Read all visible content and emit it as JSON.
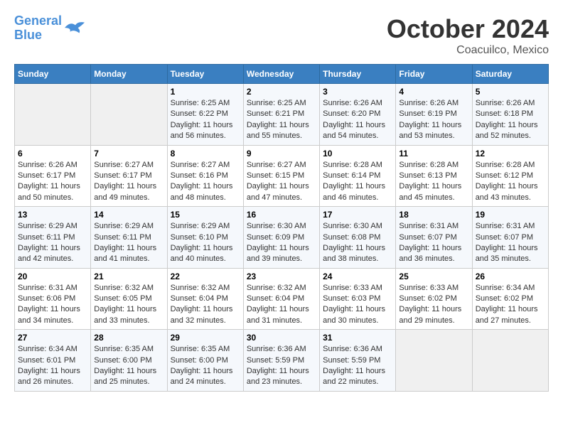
{
  "logo": {
    "line1": "General",
    "line2": "Blue"
  },
  "title": "October 2024",
  "location": "Coacuilco, Mexico",
  "weekdays": [
    "Sunday",
    "Monday",
    "Tuesday",
    "Wednesday",
    "Thursday",
    "Friday",
    "Saturday"
  ],
  "rows": [
    [
      {
        "day": "",
        "empty": true
      },
      {
        "day": "",
        "empty": true
      },
      {
        "day": "1",
        "sunrise": "Sunrise: 6:25 AM",
        "sunset": "Sunset: 6:22 PM",
        "daylight": "Daylight: 11 hours and 56 minutes."
      },
      {
        "day": "2",
        "sunrise": "Sunrise: 6:25 AM",
        "sunset": "Sunset: 6:21 PM",
        "daylight": "Daylight: 11 hours and 55 minutes."
      },
      {
        "day": "3",
        "sunrise": "Sunrise: 6:26 AM",
        "sunset": "Sunset: 6:20 PM",
        "daylight": "Daylight: 11 hours and 54 minutes."
      },
      {
        "day": "4",
        "sunrise": "Sunrise: 6:26 AM",
        "sunset": "Sunset: 6:19 PM",
        "daylight": "Daylight: 11 hours and 53 minutes."
      },
      {
        "day": "5",
        "sunrise": "Sunrise: 6:26 AM",
        "sunset": "Sunset: 6:18 PM",
        "daylight": "Daylight: 11 hours and 52 minutes."
      }
    ],
    [
      {
        "day": "6",
        "sunrise": "Sunrise: 6:26 AM",
        "sunset": "Sunset: 6:17 PM",
        "daylight": "Daylight: 11 hours and 50 minutes."
      },
      {
        "day": "7",
        "sunrise": "Sunrise: 6:27 AM",
        "sunset": "Sunset: 6:17 PM",
        "daylight": "Daylight: 11 hours and 49 minutes."
      },
      {
        "day": "8",
        "sunrise": "Sunrise: 6:27 AM",
        "sunset": "Sunset: 6:16 PM",
        "daylight": "Daylight: 11 hours and 48 minutes."
      },
      {
        "day": "9",
        "sunrise": "Sunrise: 6:27 AM",
        "sunset": "Sunset: 6:15 PM",
        "daylight": "Daylight: 11 hours and 47 minutes."
      },
      {
        "day": "10",
        "sunrise": "Sunrise: 6:28 AM",
        "sunset": "Sunset: 6:14 PM",
        "daylight": "Daylight: 11 hours and 46 minutes."
      },
      {
        "day": "11",
        "sunrise": "Sunrise: 6:28 AM",
        "sunset": "Sunset: 6:13 PM",
        "daylight": "Daylight: 11 hours and 45 minutes."
      },
      {
        "day": "12",
        "sunrise": "Sunrise: 6:28 AM",
        "sunset": "Sunset: 6:12 PM",
        "daylight": "Daylight: 11 hours and 43 minutes."
      }
    ],
    [
      {
        "day": "13",
        "sunrise": "Sunrise: 6:29 AM",
        "sunset": "Sunset: 6:11 PM",
        "daylight": "Daylight: 11 hours and 42 minutes."
      },
      {
        "day": "14",
        "sunrise": "Sunrise: 6:29 AM",
        "sunset": "Sunset: 6:11 PM",
        "daylight": "Daylight: 11 hours and 41 minutes."
      },
      {
        "day": "15",
        "sunrise": "Sunrise: 6:29 AM",
        "sunset": "Sunset: 6:10 PM",
        "daylight": "Daylight: 11 hours and 40 minutes."
      },
      {
        "day": "16",
        "sunrise": "Sunrise: 6:30 AM",
        "sunset": "Sunset: 6:09 PM",
        "daylight": "Daylight: 11 hours and 39 minutes."
      },
      {
        "day": "17",
        "sunrise": "Sunrise: 6:30 AM",
        "sunset": "Sunset: 6:08 PM",
        "daylight": "Daylight: 11 hours and 38 minutes."
      },
      {
        "day": "18",
        "sunrise": "Sunrise: 6:31 AM",
        "sunset": "Sunset: 6:07 PM",
        "daylight": "Daylight: 11 hours and 36 minutes."
      },
      {
        "day": "19",
        "sunrise": "Sunrise: 6:31 AM",
        "sunset": "Sunset: 6:07 PM",
        "daylight": "Daylight: 11 hours and 35 minutes."
      }
    ],
    [
      {
        "day": "20",
        "sunrise": "Sunrise: 6:31 AM",
        "sunset": "Sunset: 6:06 PM",
        "daylight": "Daylight: 11 hours and 34 minutes."
      },
      {
        "day": "21",
        "sunrise": "Sunrise: 6:32 AM",
        "sunset": "Sunset: 6:05 PM",
        "daylight": "Daylight: 11 hours and 33 minutes."
      },
      {
        "day": "22",
        "sunrise": "Sunrise: 6:32 AM",
        "sunset": "Sunset: 6:04 PM",
        "daylight": "Daylight: 11 hours and 32 minutes."
      },
      {
        "day": "23",
        "sunrise": "Sunrise: 6:32 AM",
        "sunset": "Sunset: 6:04 PM",
        "daylight": "Daylight: 11 hours and 31 minutes."
      },
      {
        "day": "24",
        "sunrise": "Sunrise: 6:33 AM",
        "sunset": "Sunset: 6:03 PM",
        "daylight": "Daylight: 11 hours and 30 minutes."
      },
      {
        "day": "25",
        "sunrise": "Sunrise: 6:33 AM",
        "sunset": "Sunset: 6:02 PM",
        "daylight": "Daylight: 11 hours and 29 minutes."
      },
      {
        "day": "26",
        "sunrise": "Sunrise: 6:34 AM",
        "sunset": "Sunset: 6:02 PM",
        "daylight": "Daylight: 11 hours and 27 minutes."
      }
    ],
    [
      {
        "day": "27",
        "sunrise": "Sunrise: 6:34 AM",
        "sunset": "Sunset: 6:01 PM",
        "daylight": "Daylight: 11 hours and 26 minutes."
      },
      {
        "day": "28",
        "sunrise": "Sunrise: 6:35 AM",
        "sunset": "Sunset: 6:00 PM",
        "daylight": "Daylight: 11 hours and 25 minutes."
      },
      {
        "day": "29",
        "sunrise": "Sunrise: 6:35 AM",
        "sunset": "Sunset: 6:00 PM",
        "daylight": "Daylight: 11 hours and 24 minutes."
      },
      {
        "day": "30",
        "sunrise": "Sunrise: 6:36 AM",
        "sunset": "Sunset: 5:59 PM",
        "daylight": "Daylight: 11 hours and 23 minutes."
      },
      {
        "day": "31",
        "sunrise": "Sunrise: 6:36 AM",
        "sunset": "Sunset: 5:59 PM",
        "daylight": "Daylight: 11 hours and 22 minutes."
      },
      {
        "day": "",
        "empty": true
      },
      {
        "day": "",
        "empty": true
      }
    ]
  ]
}
